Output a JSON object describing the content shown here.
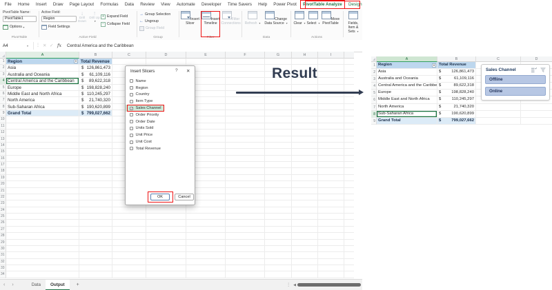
{
  "tabs": [
    {
      "label": "File",
      "style": "normal"
    },
    {
      "label": "Home",
      "style": "normal"
    },
    {
      "label": "Insert",
      "style": "normal"
    },
    {
      "label": "Draw",
      "style": "normal"
    },
    {
      "label": "Page Layout",
      "style": "normal"
    },
    {
      "label": "Formulas",
      "style": "normal"
    },
    {
      "label": "Data",
      "style": "normal"
    },
    {
      "label": "Review",
      "style": "normal"
    },
    {
      "label": "View",
      "style": "normal"
    },
    {
      "label": "Automate",
      "style": "normal"
    },
    {
      "label": "Developer",
      "style": "normal"
    },
    {
      "label": "Time Savers",
      "style": "normal"
    },
    {
      "label": "Help",
      "style": "normal"
    },
    {
      "label": "Power Pivot",
      "style": "normal"
    },
    {
      "label": "PivotTable Analyze",
      "style": "active",
      "annotated": true
    },
    {
      "label": "Design",
      "style": "contextual"
    }
  ],
  "ribbon": {
    "pivottable_name_label": "PivotTable Name:",
    "pivottable_name_value": "PivotTable1",
    "options_label": "Options",
    "group_pivottable": "PivotTable",
    "active_field_label": "Active Field:",
    "active_field_value": "Region",
    "field_settings_label": "Field Settings",
    "drill_down_label": "Drill Down",
    "drill_up_label": "Drill Up",
    "expand_field_label": "Expand Field",
    "collapse_field_label": "Collapse Field",
    "group_active_field": "Active Field",
    "group_selection_label": "Group Selection",
    "ungroup_label": "Ungroup",
    "group_field_label": "Group Field",
    "group_group": "Group",
    "insert_slicer_label": "Insert Slicer",
    "insert_timeline_label": "Insert Timeline",
    "filter_connections_label": "Filter Connections",
    "group_filter": "Filter",
    "refresh_label": "Refresh",
    "change_data_source_label": "Change Data Source",
    "group_data": "Data",
    "clear_label": "Clear",
    "select_label": "Select",
    "move_pivottable_label": "Move PivotTable",
    "group_actions": "Actions",
    "fields_items_sets_label": "Fields, Item & Sets"
  },
  "formula_bar": {
    "name_box": "A4",
    "formula": "Central America and the Caribbean"
  },
  "main_sheet": {
    "columns": [
      "A",
      "B",
      "C",
      "D",
      "E",
      "F",
      "G",
      "H",
      "I"
    ],
    "header": {
      "region": "Region",
      "revenue": "Total Revenue"
    },
    "currency": "$",
    "rows": [
      {
        "region": "Asia",
        "revenue": "126,861,473"
      },
      {
        "region": "Australia and Oceania",
        "revenue": "61,109,116"
      },
      {
        "region": "Central America and the Caribbean",
        "revenue": "89,622,318"
      },
      {
        "region": "Europe",
        "revenue": "198,828,240"
      },
      {
        "region": "Middle East and North Africa",
        "revenue": "110,245,297"
      },
      {
        "region": "North America",
        "revenue": "21,740,320"
      },
      {
        "region": "Sub-Saharan Africa",
        "revenue": "190,620,899"
      }
    ],
    "grand_total": {
      "region": "Grand Total",
      "revenue": "799,027,662"
    },
    "selected_cell": "A4",
    "visible_row_count": 34
  },
  "dialog": {
    "title": "Insert Slicers",
    "help_icon": "?",
    "close_icon": "✕",
    "fields": [
      {
        "label": "Name",
        "checked": false
      },
      {
        "label": "Region",
        "checked": false
      },
      {
        "label": "Country",
        "checked": false
      },
      {
        "label": "Item Type",
        "checked": false
      },
      {
        "label": "Sales Channel",
        "checked": true,
        "annotated": true
      },
      {
        "label": "Order Priority",
        "checked": false
      },
      {
        "label": "Order Date",
        "checked": false
      },
      {
        "label": "Units Sold",
        "checked": false
      },
      {
        "label": "Unit Price",
        "checked": false
      },
      {
        "label": "Unit Cost",
        "checked": false
      },
      {
        "label": "Total Revenue",
        "checked": false
      }
    ],
    "ok_label": "OK",
    "cancel_label": "Cancel"
  },
  "annotation": {
    "result_label": "Result"
  },
  "result_sheet": {
    "columns": [
      "A",
      "B",
      "C",
      "D"
    ],
    "header": {
      "region": "Region",
      "revenue": "Total Revenue"
    },
    "currency": "$",
    "rows": [
      {
        "region": "Asia",
        "revenue": "126,861,473"
      },
      {
        "region": "Australia and Oceania",
        "revenue": "61,109,116"
      },
      {
        "region": "Central America and the Caribbean",
        "revenue": "89,622,318"
      },
      {
        "region": "Europe",
        "revenue": "198,828,240"
      },
      {
        "region": "Middle East and North Africa",
        "revenue": "110,245,297"
      },
      {
        "region": "North America",
        "revenue": "21,740,320"
      },
      {
        "region": "Sub-Saharan Africa",
        "revenue": "190,620,899"
      }
    ],
    "grand_total": {
      "region": "Grand Total",
      "revenue": "799,027,662"
    },
    "slicer": {
      "title": "Sales Channel",
      "items": [
        "Offline",
        "Online"
      ]
    }
  },
  "sheet_tabs": {
    "prev_icon": "‹",
    "next_icon": "›",
    "tabs": [
      {
        "label": "Data",
        "active": false
      },
      {
        "label": "Output",
        "active": true
      }
    ],
    "add_label": "+"
  },
  "colors": {
    "excel_green": "#217346",
    "annotation_red": "#ee1111",
    "header_fill": "#bdd7ee",
    "grand_total_fill": "#dcebf7",
    "slicer_button_fill": "#b7c7e4",
    "checked_field_fill": "#cde9d9"
  }
}
